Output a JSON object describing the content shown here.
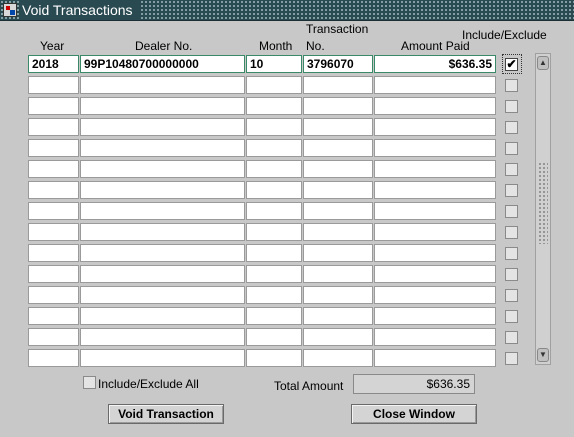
{
  "window": {
    "title": "Void Transactions"
  },
  "columns": {
    "year": "Year",
    "dealer_no": "Dealer No.",
    "month": "Month",
    "transaction_no_line1": "Transaction",
    "transaction_no_line2": "No.",
    "amount_paid": "Amount Paid",
    "include_exclude": "Include/Exclude"
  },
  "rows": [
    {
      "year": "2018",
      "dealer_no": "99P10480700000000",
      "month": "10",
      "transaction_no": "3796070",
      "amount_paid": "$636.35",
      "included": true
    },
    {
      "year": "",
      "dealer_no": "",
      "month": "",
      "transaction_no": "",
      "amount_paid": "",
      "included": false
    },
    {
      "year": "",
      "dealer_no": "",
      "month": "",
      "transaction_no": "",
      "amount_paid": "",
      "included": false
    },
    {
      "year": "",
      "dealer_no": "",
      "month": "",
      "transaction_no": "",
      "amount_paid": "",
      "included": false
    },
    {
      "year": "",
      "dealer_no": "",
      "month": "",
      "transaction_no": "",
      "amount_paid": "",
      "included": false
    },
    {
      "year": "",
      "dealer_no": "",
      "month": "",
      "transaction_no": "",
      "amount_paid": "",
      "included": false
    },
    {
      "year": "",
      "dealer_no": "",
      "month": "",
      "transaction_no": "",
      "amount_paid": "",
      "included": false
    },
    {
      "year": "",
      "dealer_no": "",
      "month": "",
      "transaction_no": "",
      "amount_paid": "",
      "included": false
    },
    {
      "year": "",
      "dealer_no": "",
      "month": "",
      "transaction_no": "",
      "amount_paid": "",
      "included": false
    },
    {
      "year": "",
      "dealer_no": "",
      "month": "",
      "transaction_no": "",
      "amount_paid": "",
      "included": false
    },
    {
      "year": "",
      "dealer_no": "",
      "month": "",
      "transaction_no": "",
      "amount_paid": "",
      "included": false
    },
    {
      "year": "",
      "dealer_no": "",
      "month": "",
      "transaction_no": "",
      "amount_paid": "",
      "included": false
    },
    {
      "year": "",
      "dealer_no": "",
      "month": "",
      "transaction_no": "",
      "amount_paid": "",
      "included": false
    },
    {
      "year": "",
      "dealer_no": "",
      "month": "",
      "transaction_no": "",
      "amount_paid": "",
      "included": false
    },
    {
      "year": "",
      "dealer_no": "",
      "month": "",
      "transaction_no": "",
      "amount_paid": "",
      "included": false
    }
  ],
  "footer": {
    "include_exclude_all_label": "Include/Exclude All",
    "include_exclude_all_checked": false,
    "total_amount_label": "Total Amount",
    "total_amount_value": "$636.35"
  },
  "buttons": {
    "void_transaction": "Void Transaction",
    "close_window": "Close Window"
  },
  "icons": {
    "app": "oracle-forms-window-icon",
    "check": "checkmark-icon",
    "scroll_up": "scroll-up-arrow-icon",
    "scroll_down": "scroll-down-arrow-icon"
  }
}
